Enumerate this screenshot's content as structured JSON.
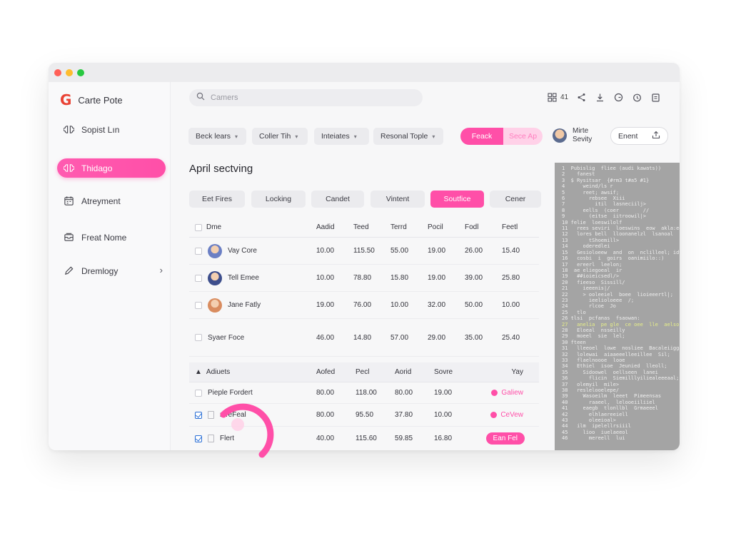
{
  "app": {
    "title": "Carte Pote",
    "logo": "G"
  },
  "sidebar": {
    "items": [
      {
        "label": "Sopist Lın",
        "icon": "brain-icon",
        "active": false
      },
      {
        "label": "Thidago",
        "icon": "brain-icon",
        "active": true
      },
      {
        "label": "Atreyment",
        "icon": "calendar-icon",
        "active": false
      },
      {
        "label": "Freat Nome",
        "icon": "inbox-icon",
        "active": false
      },
      {
        "label": "Dremlogy",
        "icon": "pencil-icon",
        "active": false
      }
    ]
  },
  "header": {
    "search_placeholder": "Camers",
    "notification_count": "41",
    "icons": [
      "grid-icon",
      "share-icon",
      "download-icon",
      "refresh-icon",
      "timer-icon",
      "clipboard-icon"
    ]
  },
  "filters": [
    {
      "label": "Beck lears"
    },
    {
      "label": "Coller Tih"
    },
    {
      "label": "Inteiates"
    },
    {
      "label": "Resonal Tople"
    }
  ],
  "split_button": {
    "primary": "Feack",
    "secondary": "Sece Ap"
  },
  "user": {
    "name_line1": "Mirte",
    "name_line2": "Sevity"
  },
  "action_button": {
    "label": "Enent"
  },
  "page_title": "April sectving",
  "tabs": [
    {
      "label": "Eet Fires",
      "active": false
    },
    {
      "label": "Locking",
      "active": false
    },
    {
      "label": "Candet",
      "active": false
    },
    {
      "label": "Vintent",
      "active": false
    },
    {
      "label": "Soutfice",
      "active": true
    },
    {
      "label": "Cener",
      "active": false
    }
  ],
  "table1": {
    "columns": [
      "Dme",
      "Aadid",
      "Teed",
      "Terrd",
      "Pocil",
      "Fodl",
      "Feetl"
    ],
    "rows": [
      {
        "name": "Vay Core",
        "avatar": "#6b7fc4",
        "values": [
          "10.00",
          "115.50",
          "55.00",
          "19.00",
          "26.00",
          "15.40"
        ]
      },
      {
        "name": "Tell Emee",
        "avatar": "#3d4e8c",
        "values": [
          "10.00",
          "78.80",
          "15.80",
          "19.00",
          "39.00",
          "25.80"
        ]
      },
      {
        "name": "Jane Fatly",
        "avatar": "#d98c5f",
        "values": [
          "19.00",
          "76.00",
          "10.00",
          "32.00",
          "50.00",
          "10.00"
        ]
      },
      {
        "name": "Syaer Foce",
        "avatar": "",
        "values": [
          "46.00",
          "14.80",
          "57.00",
          "29.00",
          "35.00",
          "25.40"
        ]
      }
    ]
  },
  "table2": {
    "columns": [
      "Adiuets",
      "Aofed",
      "Pecl",
      "Aorid",
      "Sovre",
      "Yay"
    ],
    "rows": [
      {
        "name": "Pieple Fordert",
        "checked": false,
        "values": [
          "80.00",
          "118.00",
          "80.00",
          "19.00"
        ],
        "status": "Galiew",
        "status_type": "dot"
      },
      {
        "name": "mreFeal",
        "checked": true,
        "values": [
          "80.00",
          "95.50",
          "37.80",
          "10.00"
        ],
        "status": "CeVew",
        "status_type": "dot"
      },
      {
        "name": "Flert",
        "checked": true,
        "values": [
          "40.00",
          "115.60",
          "59.85",
          "16.80"
        ],
        "status": "Ean Fel",
        "status_type": "pill"
      }
    ]
  },
  "colors": {
    "accent": "#ff4fa8",
    "accent_soft": "#ffd1e8",
    "code_bg": "#a4a4a4"
  },
  "code_lines": [
    "1  Pubislig  fliee (audi kawats))",
    "2    fanest",
    "3  $ Rysitsar  {#rm3 t#a5 #1}",
    "4      weind/ls r",
    "5      reet; awsif;",
    "6        rebsee  Xiii",
    "7          itil  lasneciilj>",
    "8      eells  (coer        //",
    "9        (eitse  iitroowil|>",
    "10 felie  loeswilolf",
    "11   rees seviri  loeswins  eow  akla:eg",
    "12   lores bell  lloonanelzl  lsanoal",
    "13       tShoemill>",
    "14     oderedlei",
    "15   Gesioloeew  and  on  nclilleel; idt",
    "16   cosbi  i  goirs  oanimiilo::)",
    "17   ereerl  leelon;",
    "18  ae eliegoeal  ir",
    "19   ##ioieicsedl/>",
    "20   fieeso  Sissill/",
    "21     ieeenis|/",
    "22     > ooleeiel  boee  lioieeertl|;",
    "23       ieelioloeee  /;",
    "24       rlcoe  Jo",
    "25   tlo",
    "26 tlsi  pcfanas  fsaowan:",
    "27   anelia  pe gle  ce oee  lle  aelsolt",
    "28   Eloeal  nsseilly",
    "29   moeel  sie  lel;",
    "30 fteen",
    "31   lleeoel  lowe  nosliee  Bacaleiiggai  eft",
    "32   lolewai  aiaaeeelleeillee  Sil;",
    "33   flaelnoooe  looe",
    "34   Ethiel  isoe  Jeunied  lleoll;",
    "35     Sidoowel  oellseen  lanei",
    "36       flicin  Siemilllyiliealeeeaal;",
    "37   olemyil  mile>",
    "38   reslelooelepe/",
    "39     Wasoeilm  leeet  Pimeensas",
    "40       raaeel,  lelooeiiliiel",
    "41     eaegb  tlonllbl  Grmaeeel",
    "42       elhlaereeiell",
    "43       oleeioal>",
    "44   ilm  ipelellrsiiil",
    "45     lioo  iuelaeeol",
    "46       mereell  lui"
  ]
}
